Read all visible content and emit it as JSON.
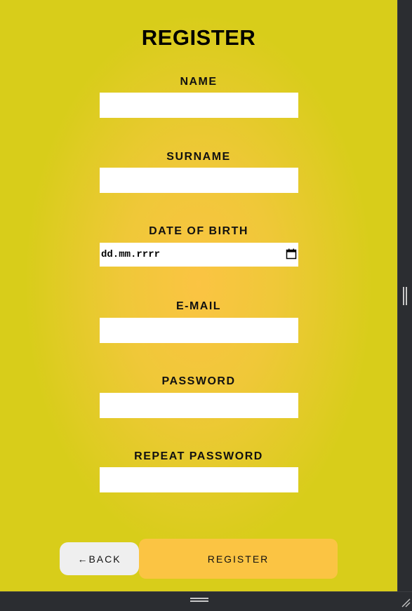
{
  "form": {
    "title": "REGISTER",
    "fields": [
      {
        "label": "NAME",
        "value": ""
      },
      {
        "label": "SURNAME",
        "value": ""
      },
      {
        "label": "DATE OF BIRTH",
        "placeholder": "dd.mm.rrrr",
        "icon": "calendar-icon"
      },
      {
        "label": "E-MAIL",
        "value": ""
      },
      {
        "label": "PASSWORD",
        "value": ""
      },
      {
        "label": "REPEAT PASSWORD",
        "value": ""
      }
    ],
    "back_label": "←BACK",
    "register_label": "REGISTER"
  },
  "colors": {
    "background": "#d8cd1a",
    "background_center": "#fbc443",
    "register_button": "#fbc443",
    "back_button": "#efefef",
    "frame": "#2b2d31"
  }
}
